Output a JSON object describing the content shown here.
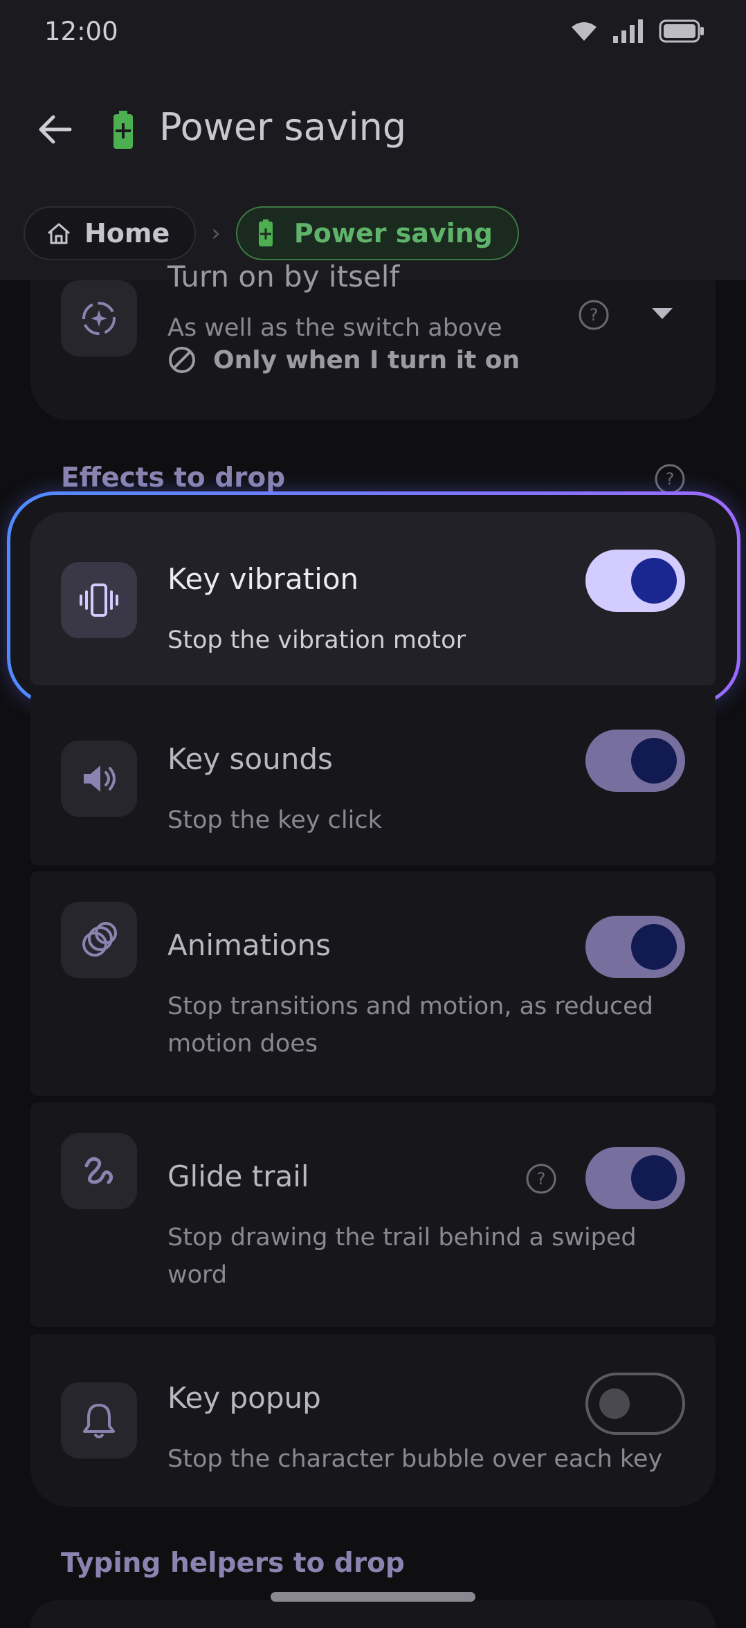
{
  "status": {
    "time": "12:00"
  },
  "header": {
    "title": "Power saving"
  },
  "breadcrumb": {
    "home": "Home",
    "current": "Power saving"
  },
  "auto_on": {
    "title": "Turn on by itself",
    "subtitle": "As well as the switch above",
    "value": "Only when I turn it on"
  },
  "sections": {
    "effects": "Effects to drop",
    "typing": "Typing helpers to drop"
  },
  "effects": [
    {
      "title": "Key vibration",
      "subtitle": "Stop the vibration motor",
      "enabled": true
    },
    {
      "title": "Key sounds",
      "subtitle": "Stop the key click",
      "enabled": true
    },
    {
      "title": "Animations",
      "subtitle": "Stop transitions and motion, as reduced motion does",
      "enabled": true
    },
    {
      "title": "Glide trail",
      "subtitle": "Stop drawing the trail behind a swiped word",
      "enabled": true
    },
    {
      "title": "Key popup",
      "subtitle": "Stop the character bubble over each key",
      "enabled": false
    }
  ],
  "colors": {
    "accent": "#d3ccff",
    "highlight_start": "#4f8bff",
    "highlight_end": "#9b6bff",
    "battery": "#4caf50"
  }
}
